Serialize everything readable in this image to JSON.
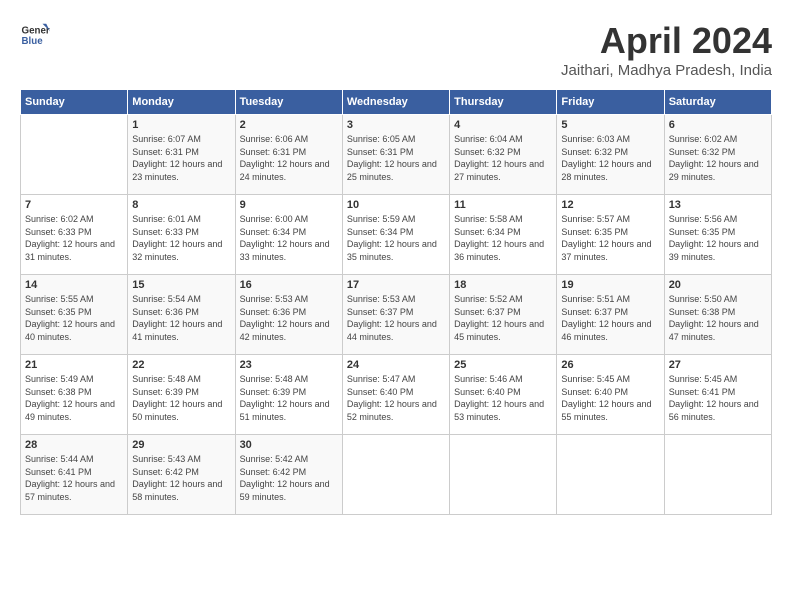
{
  "header": {
    "logo_line1": "General",
    "logo_line2": "Blue",
    "month_year": "April 2024",
    "location": "Jaithari, Madhya Pradesh, India"
  },
  "weekdays": [
    "Sunday",
    "Monday",
    "Tuesday",
    "Wednesday",
    "Thursday",
    "Friday",
    "Saturday"
  ],
  "weeks": [
    [
      {
        "day": "",
        "sunrise": "",
        "sunset": "",
        "daylight": ""
      },
      {
        "day": "1",
        "sunrise": "Sunrise: 6:07 AM",
        "sunset": "Sunset: 6:31 PM",
        "daylight": "Daylight: 12 hours and 23 minutes."
      },
      {
        "day": "2",
        "sunrise": "Sunrise: 6:06 AM",
        "sunset": "Sunset: 6:31 PM",
        "daylight": "Daylight: 12 hours and 24 minutes."
      },
      {
        "day": "3",
        "sunrise": "Sunrise: 6:05 AM",
        "sunset": "Sunset: 6:31 PM",
        "daylight": "Daylight: 12 hours and 25 minutes."
      },
      {
        "day": "4",
        "sunrise": "Sunrise: 6:04 AM",
        "sunset": "Sunset: 6:32 PM",
        "daylight": "Daylight: 12 hours and 27 minutes."
      },
      {
        "day": "5",
        "sunrise": "Sunrise: 6:03 AM",
        "sunset": "Sunset: 6:32 PM",
        "daylight": "Daylight: 12 hours and 28 minutes."
      },
      {
        "day": "6",
        "sunrise": "Sunrise: 6:02 AM",
        "sunset": "Sunset: 6:32 PM",
        "daylight": "Daylight: 12 hours and 29 minutes."
      }
    ],
    [
      {
        "day": "7",
        "sunrise": "Sunrise: 6:02 AM",
        "sunset": "Sunset: 6:33 PM",
        "daylight": "Daylight: 12 hours and 31 minutes."
      },
      {
        "day": "8",
        "sunrise": "Sunrise: 6:01 AM",
        "sunset": "Sunset: 6:33 PM",
        "daylight": "Daylight: 12 hours and 32 minutes."
      },
      {
        "day": "9",
        "sunrise": "Sunrise: 6:00 AM",
        "sunset": "Sunset: 6:34 PM",
        "daylight": "Daylight: 12 hours and 33 minutes."
      },
      {
        "day": "10",
        "sunrise": "Sunrise: 5:59 AM",
        "sunset": "Sunset: 6:34 PM",
        "daylight": "Daylight: 12 hours and 35 minutes."
      },
      {
        "day": "11",
        "sunrise": "Sunrise: 5:58 AM",
        "sunset": "Sunset: 6:34 PM",
        "daylight": "Daylight: 12 hours and 36 minutes."
      },
      {
        "day": "12",
        "sunrise": "Sunrise: 5:57 AM",
        "sunset": "Sunset: 6:35 PM",
        "daylight": "Daylight: 12 hours and 37 minutes."
      },
      {
        "day": "13",
        "sunrise": "Sunrise: 5:56 AM",
        "sunset": "Sunset: 6:35 PM",
        "daylight": "Daylight: 12 hours and 39 minutes."
      }
    ],
    [
      {
        "day": "14",
        "sunrise": "Sunrise: 5:55 AM",
        "sunset": "Sunset: 6:35 PM",
        "daylight": "Daylight: 12 hours and 40 minutes."
      },
      {
        "day": "15",
        "sunrise": "Sunrise: 5:54 AM",
        "sunset": "Sunset: 6:36 PM",
        "daylight": "Daylight: 12 hours and 41 minutes."
      },
      {
        "day": "16",
        "sunrise": "Sunrise: 5:53 AM",
        "sunset": "Sunset: 6:36 PM",
        "daylight": "Daylight: 12 hours and 42 minutes."
      },
      {
        "day": "17",
        "sunrise": "Sunrise: 5:53 AM",
        "sunset": "Sunset: 6:37 PM",
        "daylight": "Daylight: 12 hours and 44 minutes."
      },
      {
        "day": "18",
        "sunrise": "Sunrise: 5:52 AM",
        "sunset": "Sunset: 6:37 PM",
        "daylight": "Daylight: 12 hours and 45 minutes."
      },
      {
        "day": "19",
        "sunrise": "Sunrise: 5:51 AM",
        "sunset": "Sunset: 6:37 PM",
        "daylight": "Daylight: 12 hours and 46 minutes."
      },
      {
        "day": "20",
        "sunrise": "Sunrise: 5:50 AM",
        "sunset": "Sunset: 6:38 PM",
        "daylight": "Daylight: 12 hours and 47 minutes."
      }
    ],
    [
      {
        "day": "21",
        "sunrise": "Sunrise: 5:49 AM",
        "sunset": "Sunset: 6:38 PM",
        "daylight": "Daylight: 12 hours and 49 minutes."
      },
      {
        "day": "22",
        "sunrise": "Sunrise: 5:48 AM",
        "sunset": "Sunset: 6:39 PM",
        "daylight": "Daylight: 12 hours and 50 minutes."
      },
      {
        "day": "23",
        "sunrise": "Sunrise: 5:48 AM",
        "sunset": "Sunset: 6:39 PM",
        "daylight": "Daylight: 12 hours and 51 minutes."
      },
      {
        "day": "24",
        "sunrise": "Sunrise: 5:47 AM",
        "sunset": "Sunset: 6:40 PM",
        "daylight": "Daylight: 12 hours and 52 minutes."
      },
      {
        "day": "25",
        "sunrise": "Sunrise: 5:46 AM",
        "sunset": "Sunset: 6:40 PM",
        "daylight": "Daylight: 12 hours and 53 minutes."
      },
      {
        "day": "26",
        "sunrise": "Sunrise: 5:45 AM",
        "sunset": "Sunset: 6:40 PM",
        "daylight": "Daylight: 12 hours and 55 minutes."
      },
      {
        "day": "27",
        "sunrise": "Sunrise: 5:45 AM",
        "sunset": "Sunset: 6:41 PM",
        "daylight": "Daylight: 12 hours and 56 minutes."
      }
    ],
    [
      {
        "day": "28",
        "sunrise": "Sunrise: 5:44 AM",
        "sunset": "Sunset: 6:41 PM",
        "daylight": "Daylight: 12 hours and 57 minutes."
      },
      {
        "day": "29",
        "sunrise": "Sunrise: 5:43 AM",
        "sunset": "Sunset: 6:42 PM",
        "daylight": "Daylight: 12 hours and 58 minutes."
      },
      {
        "day": "30",
        "sunrise": "Sunrise: 5:42 AM",
        "sunset": "Sunset: 6:42 PM",
        "daylight": "Daylight: 12 hours and 59 minutes."
      },
      {
        "day": "",
        "sunrise": "",
        "sunset": "",
        "daylight": ""
      },
      {
        "day": "",
        "sunrise": "",
        "sunset": "",
        "daylight": ""
      },
      {
        "day": "",
        "sunrise": "",
        "sunset": "",
        "daylight": ""
      },
      {
        "day": "",
        "sunrise": "",
        "sunset": "",
        "daylight": ""
      }
    ]
  ]
}
